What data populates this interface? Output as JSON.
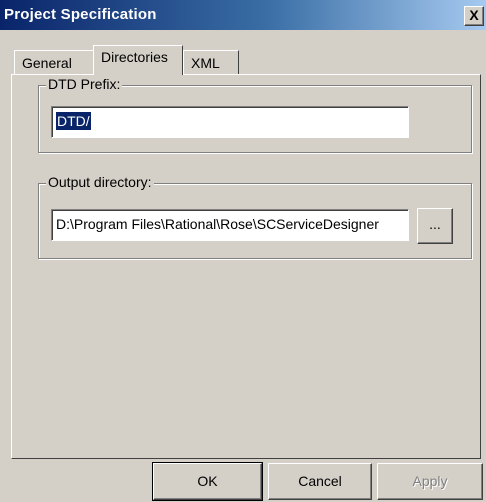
{
  "window": {
    "title": "Project Specification",
    "close_label": "X"
  },
  "tabs": [
    {
      "label": "General",
      "active": false
    },
    {
      "label": "Directories",
      "active": true
    },
    {
      "label": "XML",
      "active": false
    }
  ],
  "dtd_group": {
    "legend": "DTD Prefix:",
    "value": "DTD/"
  },
  "output_group": {
    "legend": "Output directory:",
    "value": "D:\\Program Files\\Rational\\Rose\\SCServiceDesigner",
    "browse_label": "..."
  },
  "buttons": {
    "ok": "OK",
    "cancel": "Cancel",
    "apply": "Apply"
  }
}
